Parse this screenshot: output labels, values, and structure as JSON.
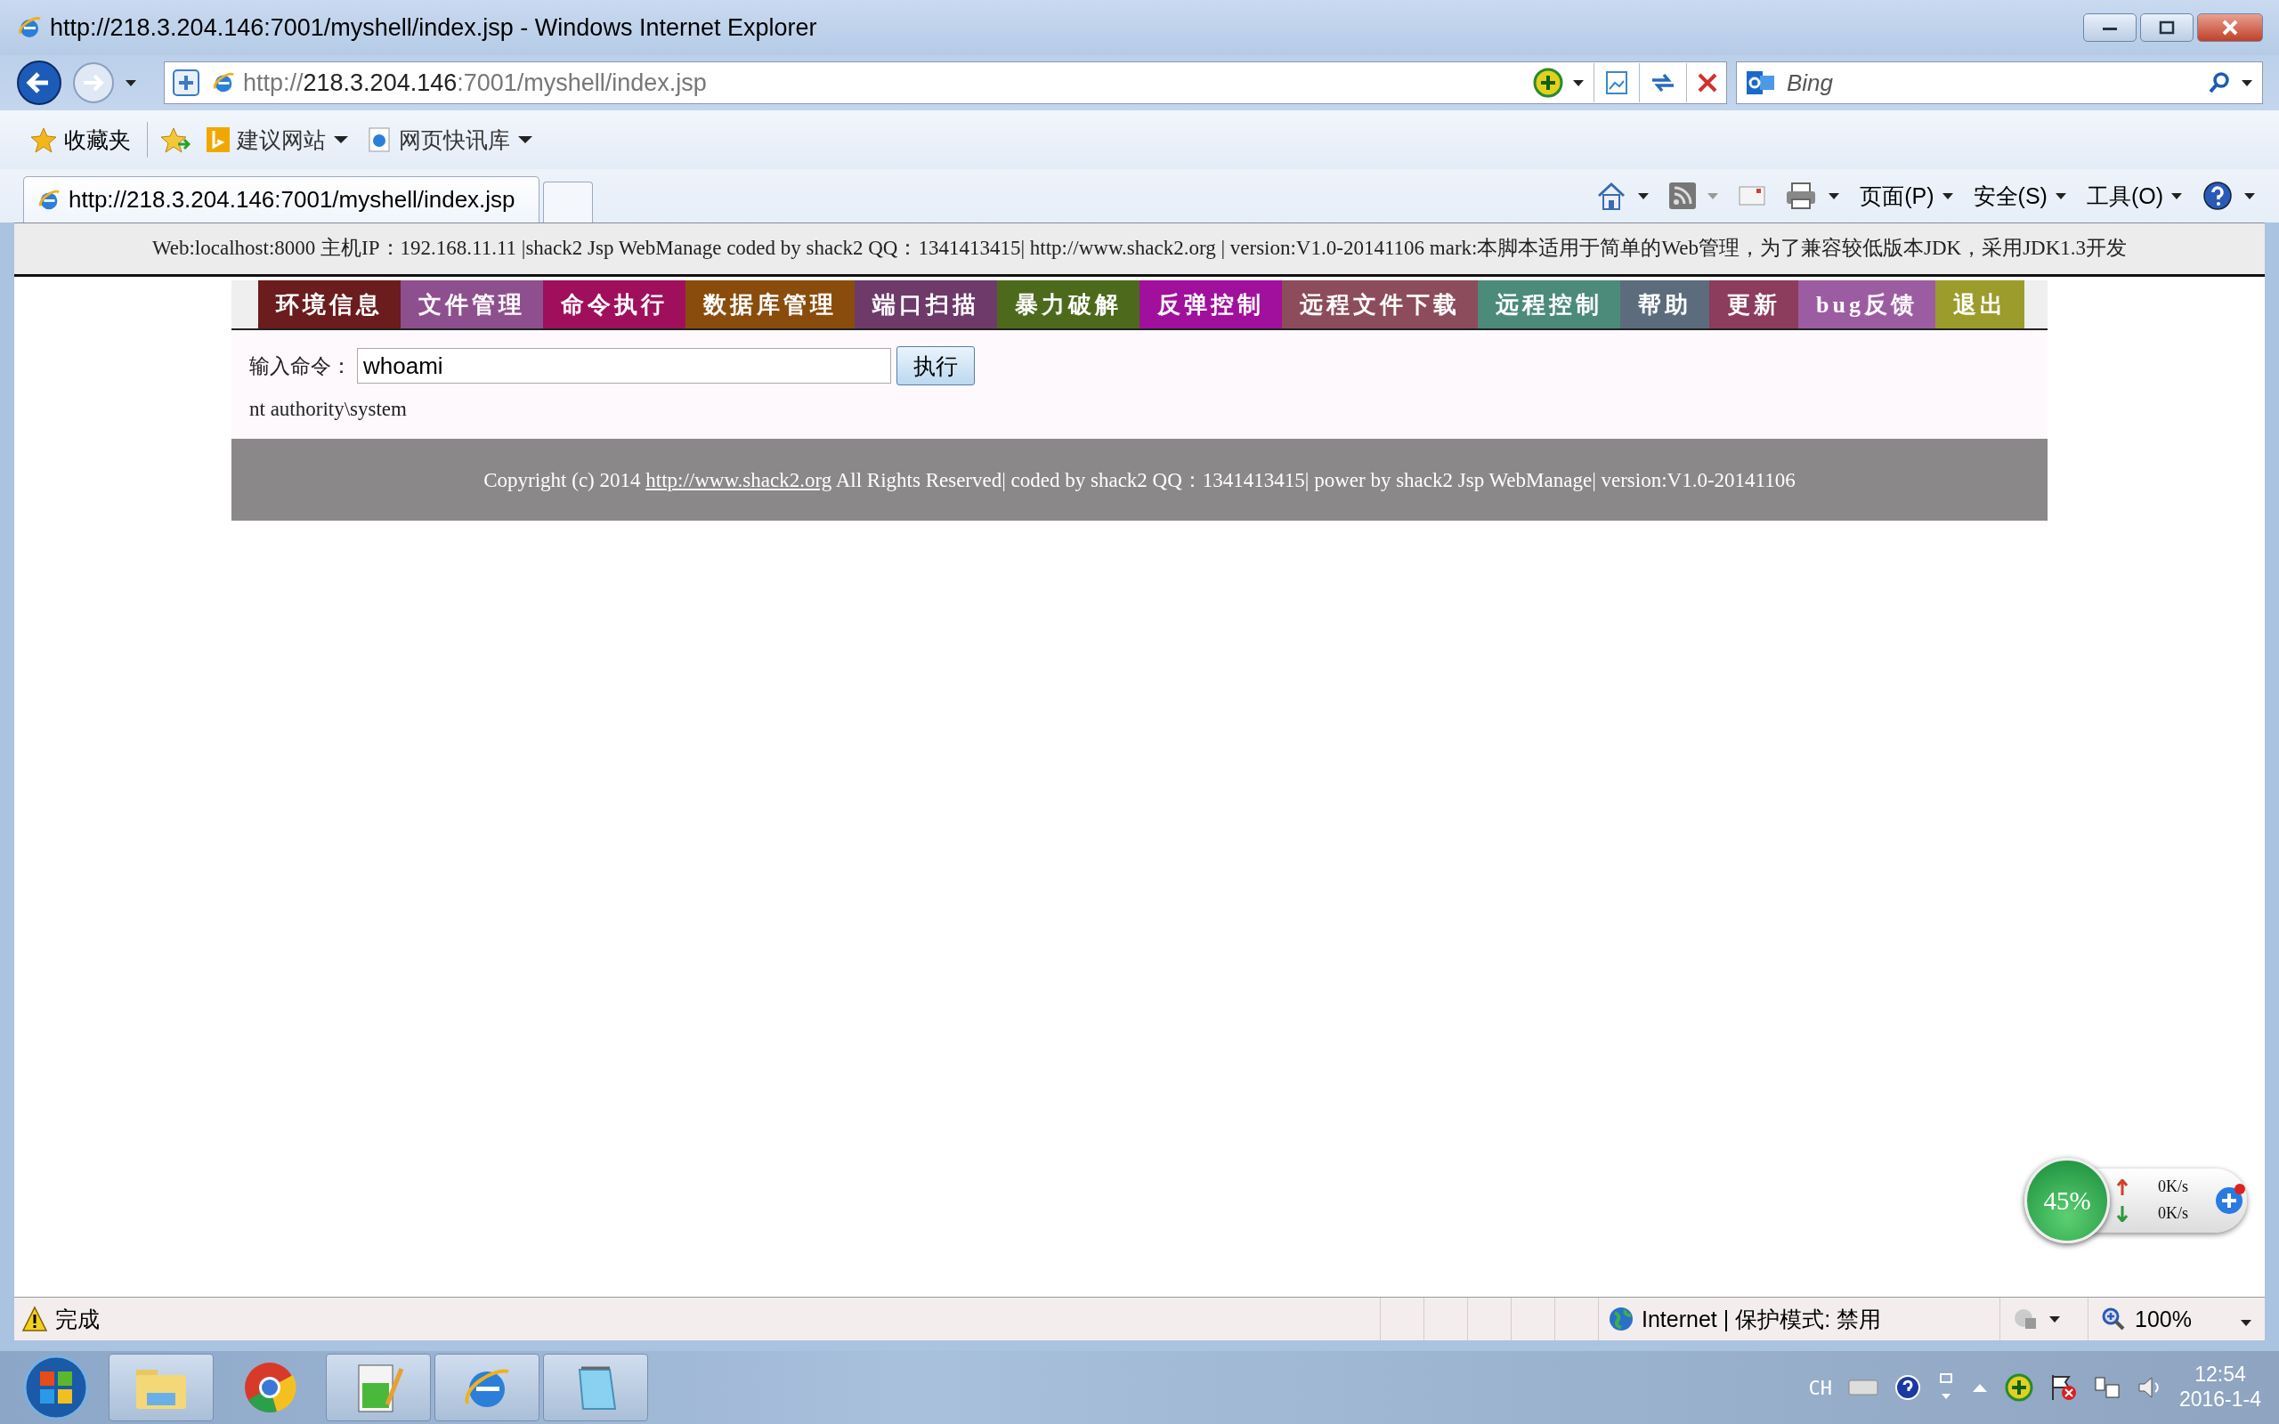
{
  "window": {
    "title": "http://218.3.204.146:7001/myshell/index.jsp - Windows Internet Explorer"
  },
  "address_bar": {
    "url_parts": [
      {
        "text": "http://",
        "emphasis": false
      },
      {
        "text": "218.3.204.146",
        "emphasis": true
      },
      {
        "text": ":7001/myshell/index.jsp",
        "emphasis": false
      }
    ]
  },
  "search": {
    "placeholder": "Bing"
  },
  "favorites_bar": {
    "label": "收藏夹",
    "items": [
      {
        "label": "建议网站",
        "kind": "bing"
      },
      {
        "label": "网页快讯库",
        "kind": "ie"
      }
    ]
  },
  "tabs": [
    {
      "label": "http://218.3.204.146:7001/myshell/index.jsp",
      "selected": true
    }
  ],
  "command_bar": [
    {
      "label": "页面(P)"
    },
    {
      "label": "安全(S)"
    },
    {
      "label": "工具(O)"
    }
  ],
  "page": {
    "info": "Web:localhost:8000 主机IP：192.168.11.11 |shack2 Jsp WebManage coded by shack2 QQ：1341413415| http://www.shack2.org | version:V1.0-20141106 mark:本脚本适用于简单的Web管理，为了兼容较低版本JDK，采用JDK1.3开发",
    "menu": [
      {
        "label": "环境信息",
        "color": "#6b1c1c"
      },
      {
        "label": "文件管理",
        "color": "#8e4f8e"
      },
      {
        "label": "命令执行",
        "color": "#a00f5c"
      },
      {
        "label": "数据库管理",
        "color": "#8a4c0c"
      },
      {
        "label": "端口扫描",
        "color": "#6e3a6a"
      },
      {
        "label": "暴力破解",
        "color": "#4d6a1c"
      },
      {
        "label": "反弹控制",
        "color": "#a0109c"
      },
      {
        "label": "远程文件下载",
        "color": "#8c4c5c"
      },
      {
        "label": "远程控制",
        "color": "#4c8a7a"
      },
      {
        "label": "帮助",
        "color": "#5c6c7c"
      },
      {
        "label": "更新",
        "color": "#8c3c5c"
      },
      {
        "label": "bug反馈",
        "color": "#9c5ca2"
      },
      {
        "label": "退出",
        "color": "#9c9c2c"
      }
    ],
    "command": {
      "label": "输入命令：",
      "value": "whoami",
      "button": "执行"
    },
    "output": "nt authority\\system",
    "footer": {
      "before": "Copyright (c) 2014 ",
      "link": "http://www.shack2.org",
      "after": " All Rights Reserved| coded by shack2 QQ：1341413415| power by shack2 Jsp WebManage| version:V1.0-20141106"
    }
  },
  "net_widget": {
    "percent": "45%",
    "upload": "0K/s",
    "download": "0K/s"
  },
  "status_bar": {
    "text": "完成",
    "zone": "Internet | 保护模式: 禁用",
    "zoom": "100%"
  },
  "tray": {
    "language": "CH",
    "time": "12:54",
    "date": "2016-1-4"
  }
}
